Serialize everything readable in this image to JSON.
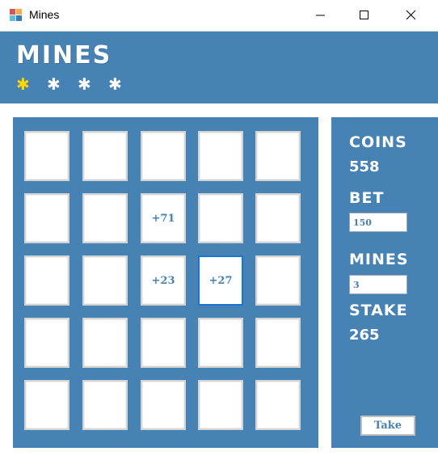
{
  "window": {
    "title": "Mines"
  },
  "header": {
    "title": "MINES",
    "stars": [
      {
        "glyph": "✱",
        "color": "#ffd700"
      },
      {
        "glyph": "✱",
        "color": "#ffffff"
      },
      {
        "glyph": "✱",
        "color": "#ffffff"
      },
      {
        "glyph": "✱",
        "color": "#ffffff"
      }
    ]
  },
  "grid": {
    "rows": 5,
    "cols": 5,
    "tiles": [
      "",
      "",
      "",
      "",
      "",
      "",
      "",
      "+71",
      "",
      "",
      "",
      "",
      "+23",
      "+27",
      "",
      "",
      "",
      "",
      "",
      "",
      "",
      "",
      "",
      "",
      ""
    ],
    "selected_index": 13
  },
  "side": {
    "coins_label": "COINS",
    "coins_value": "558",
    "bet_label": "BET",
    "bet_value": "150",
    "mines_label": "MINES",
    "mines_value": "3",
    "stake_label": "STAKE",
    "stake_value": "265",
    "take_label": "Take"
  },
  "colors": {
    "panel": "#4682b4",
    "accent_star": "#ffd700",
    "selected_border": "#1976d2"
  }
}
